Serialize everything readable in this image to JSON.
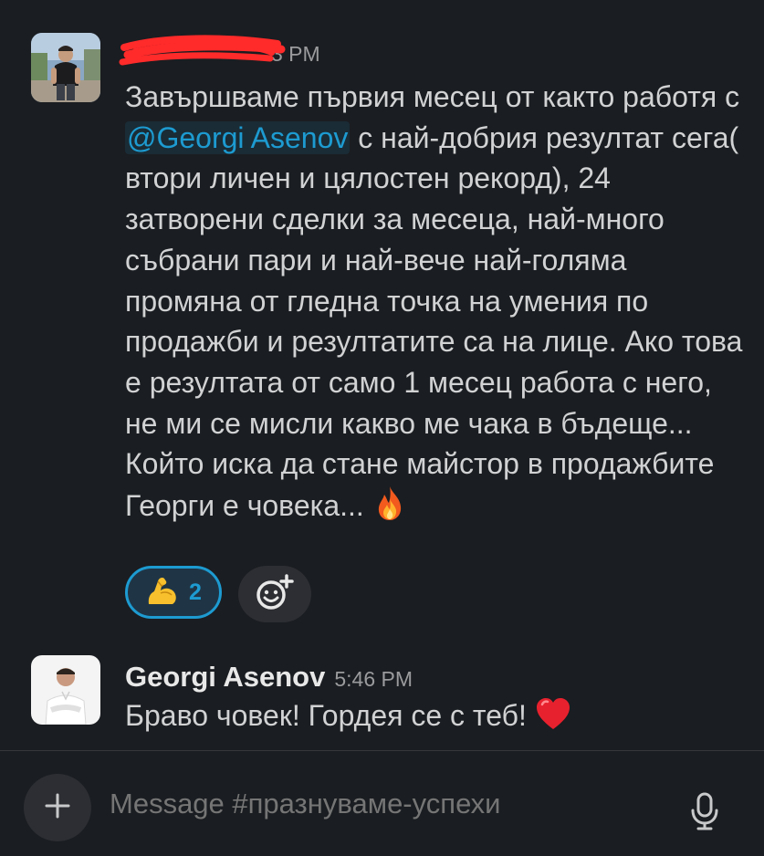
{
  "messages": [
    {
      "author": "",
      "time": "3 PM",
      "text_parts": {
        "before": "Завършваме първия месец от както работя с ",
        "mention": "@Georgi Asenov",
        "after": " с най-добрия резултат сега( втори личен и цялостен рекорд), 24 затворени сделки за месеца, най-много събрани пари и най-вече най-голяма промяна от гледна точка на умения по продажби и резултатите са на лице. Ако това е резултата от само 1 месец работа с него, не ми се мисли какво ме чака в бъдеще... Който иска да стане майстор в продажбите Георги е човека... "
      },
      "end_emoji": "fire-emoji",
      "reactions": [
        {
          "emoji": "flexed-biceps-emoji",
          "count": "2"
        }
      ],
      "add_reaction_icon": "add-emoji-icon"
    },
    {
      "author": "Georgi Asenov",
      "time": "5:46 PM",
      "text": "Браво човек! Гордея се с теб! ",
      "end_emoji": "red-heart-emoji"
    }
  ],
  "composer": {
    "placeholder": "Message #празнуваме-успехи",
    "left_icon": "plus-icon",
    "right_icon": "microphone-icon"
  },
  "colors": {
    "background": "#1a1d21",
    "text": "#d1d2d3",
    "mention": "#1d9bd1",
    "timestamp": "#9a9b9d",
    "reaction_border": "#1d9bd1",
    "redaction": "#ff2a2a"
  }
}
